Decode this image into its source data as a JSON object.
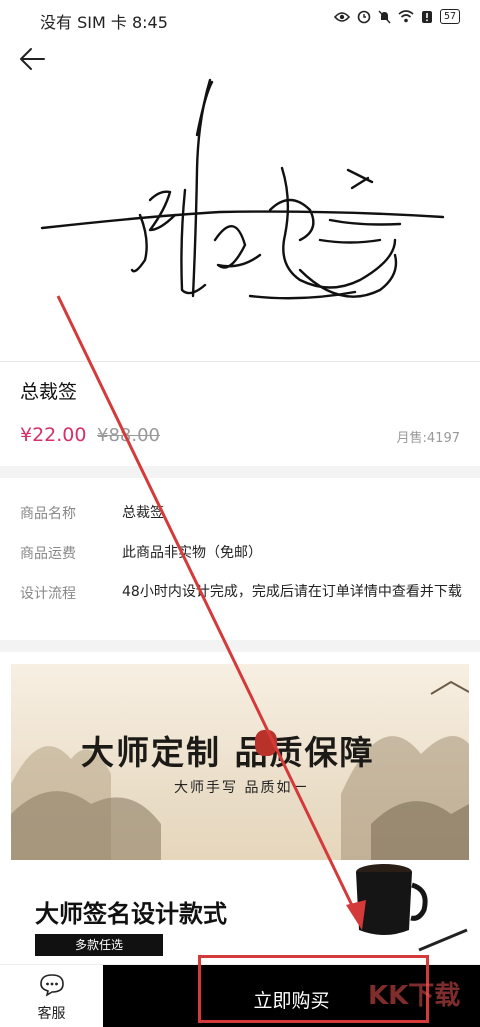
{
  "status_bar": {
    "left_text": "没有 SIM 卡 8:45",
    "battery": "57"
  },
  "product": {
    "title": "总裁签",
    "price": "¥22.00",
    "original_price": "¥88.00",
    "sales": "月售:4197"
  },
  "details": [
    {
      "label": "商品名称",
      "value": "总裁签"
    },
    {
      "label": "商品运费",
      "value": "此商品非实物（免邮）"
    },
    {
      "label": "设计流程",
      "value": "48小时内设计完成，完成后请在订单详情中查看并下载"
    }
  ],
  "banner": {
    "headline": "大师定制   品质保障",
    "subline": "大师手写  品质如一",
    "section_title": "大师签名设计款式",
    "tag": "多款任选"
  },
  "bottom_bar": {
    "service_label": "客服",
    "buy_label": "立即购买"
  },
  "watermark": "KK下载",
  "colors": {
    "price": "#d6306b",
    "buy_button": "#000000",
    "annotation": "#d53a3a"
  }
}
